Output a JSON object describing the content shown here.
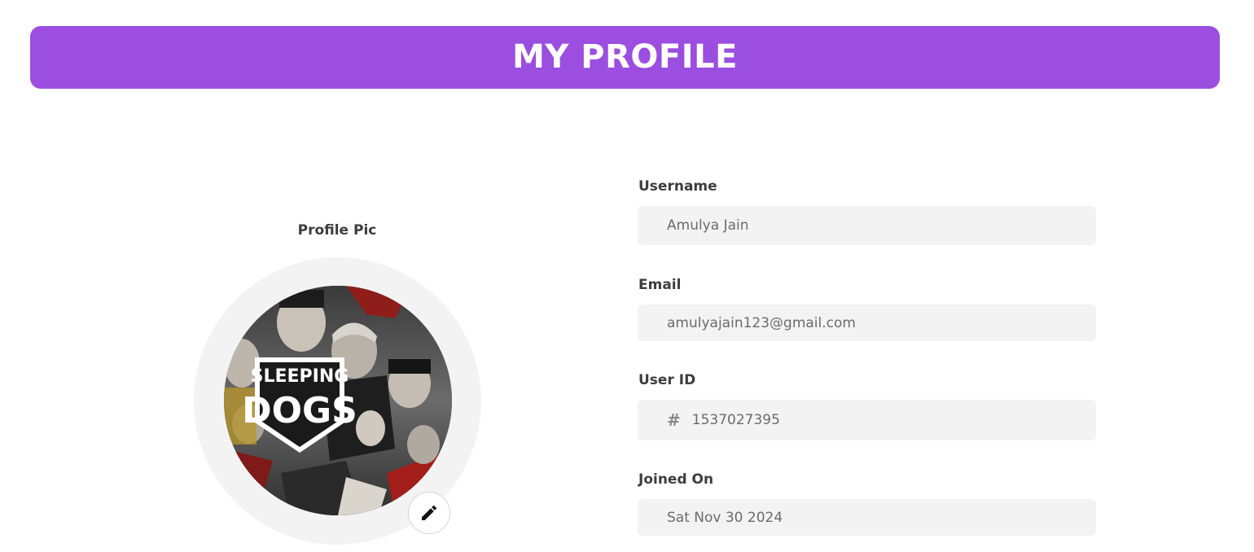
{
  "header": {
    "title": "MY PROFILE"
  },
  "profile_pic": {
    "label": "Profile Pic",
    "image_text_line1": "SLEEPING",
    "image_text_line2": "DOGS",
    "edit_icon": "pencil-icon"
  },
  "fields": {
    "username": {
      "label": "Username",
      "value": "Amulya Jain"
    },
    "email": {
      "label": "Email",
      "value": "amulyajain123@gmail.com"
    },
    "user_id": {
      "label": "User ID",
      "prefix": "#",
      "value": "1537027395"
    },
    "joined_on": {
      "label": "Joined On",
      "value": "Sat Nov 30 2024"
    }
  },
  "colors": {
    "accent": "#9b4ee0",
    "field_bg": "#f3f3f3",
    "ring_bg": "#f3f3f3"
  }
}
